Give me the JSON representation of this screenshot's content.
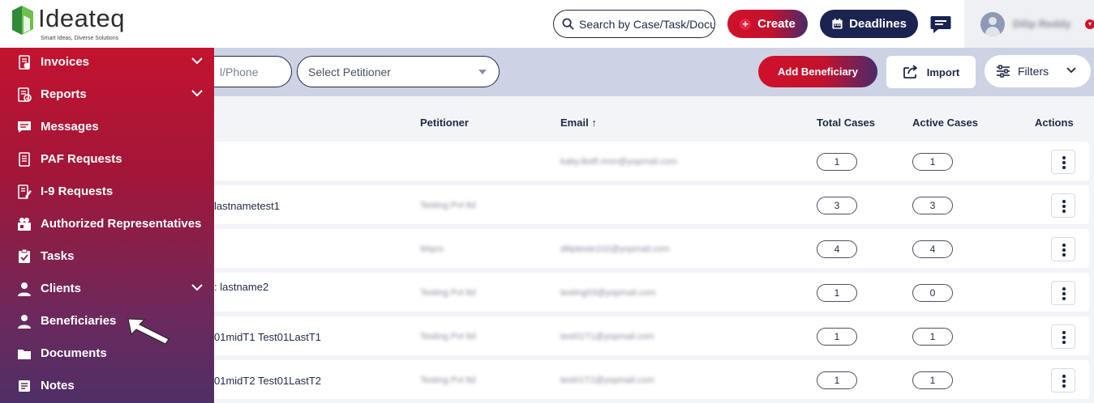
{
  "brand": {
    "name": "Ideateq",
    "tagline": "Smart Ideas, Diverse Solutions"
  },
  "header": {
    "search_placeholder": "Search by Case/Task/Docu",
    "create_label": "Create",
    "deadlines_label": "Deadlines",
    "user_name": "Dilip Reddy"
  },
  "sidebar": {
    "items": [
      {
        "label": "Invoices",
        "icon": "invoice-icon",
        "expandable": true
      },
      {
        "label": "Reports",
        "icon": "reports-icon",
        "expandable": true
      },
      {
        "label": "Messages",
        "icon": "messages-icon",
        "expandable": false
      },
      {
        "label": "PAF Requests",
        "icon": "paf-requests-icon",
        "expandable": false
      },
      {
        "label": "I-9 Requests",
        "icon": "i9-requests-icon",
        "expandable": false
      },
      {
        "label": "Authorized Representatives",
        "icon": "authorized-representatives-icon",
        "expandable": false
      },
      {
        "label": "Tasks",
        "icon": "tasks-icon",
        "expandable": false
      },
      {
        "label": "Clients",
        "icon": "clients-icon",
        "expandable": true
      },
      {
        "label": "Beneficiaries",
        "icon": "beneficiaries-icon",
        "expandable": false
      },
      {
        "label": "Documents",
        "icon": "documents-icon",
        "expandable": false
      },
      {
        "label": "Notes",
        "icon": "notes-icon",
        "expandable": false
      }
    ]
  },
  "filters": {
    "email_phone_placeholder": "l/Phone",
    "petitioner_placeholder": "Select Petitioner",
    "add_beneficiary_label": "Add Beneficiary",
    "import_label": "Import",
    "filters_label": "Filters"
  },
  "table": {
    "headers": {
      "petitioner": "Petitioner",
      "email": "Email",
      "email_sort": "↑",
      "total_cases": "Total Cases",
      "active_cases": "Active Cases",
      "actions": "Actions"
    },
    "rows": [
      {
        "name": "",
        "petitioner": "",
        "email": "kaby.tkeff.rmm@yopmail.com",
        "total_cases": "1",
        "active_cases": "1"
      },
      {
        "name": "lastnametest1",
        "petitioner": "Testing Pvt ltd",
        "email": "",
        "total_cases": "3",
        "active_cases": "3"
      },
      {
        "name": "",
        "petitioner": "Wipro",
        "email": "dilipteste102@yopmail.com",
        "total_cases": "4",
        "active_cases": "4"
      },
      {
        "name": ": lastname2",
        "petitioner": "Testing Pvt ltd",
        "email": "testing03@yopmail.com",
        "total_cases": "1",
        "active_cases": "0"
      },
      {
        "name": "01midT1 Test01LastT1",
        "petitioner": "Testing Pvt ltd",
        "email": "test01T1@yopmail.com",
        "total_cases": "1",
        "active_cases": "1"
      },
      {
        "name": "01midT2 Test01LastT2",
        "petitioner": "Testing Pvt ltd",
        "email": "test01T2@yopmail.com",
        "total_cases": "1",
        "active_cases": "1"
      }
    ]
  },
  "colors": {
    "brand_red": "#d0112b",
    "navy": "#1b2450",
    "sidebar_bottom": "#4e2f66"
  }
}
